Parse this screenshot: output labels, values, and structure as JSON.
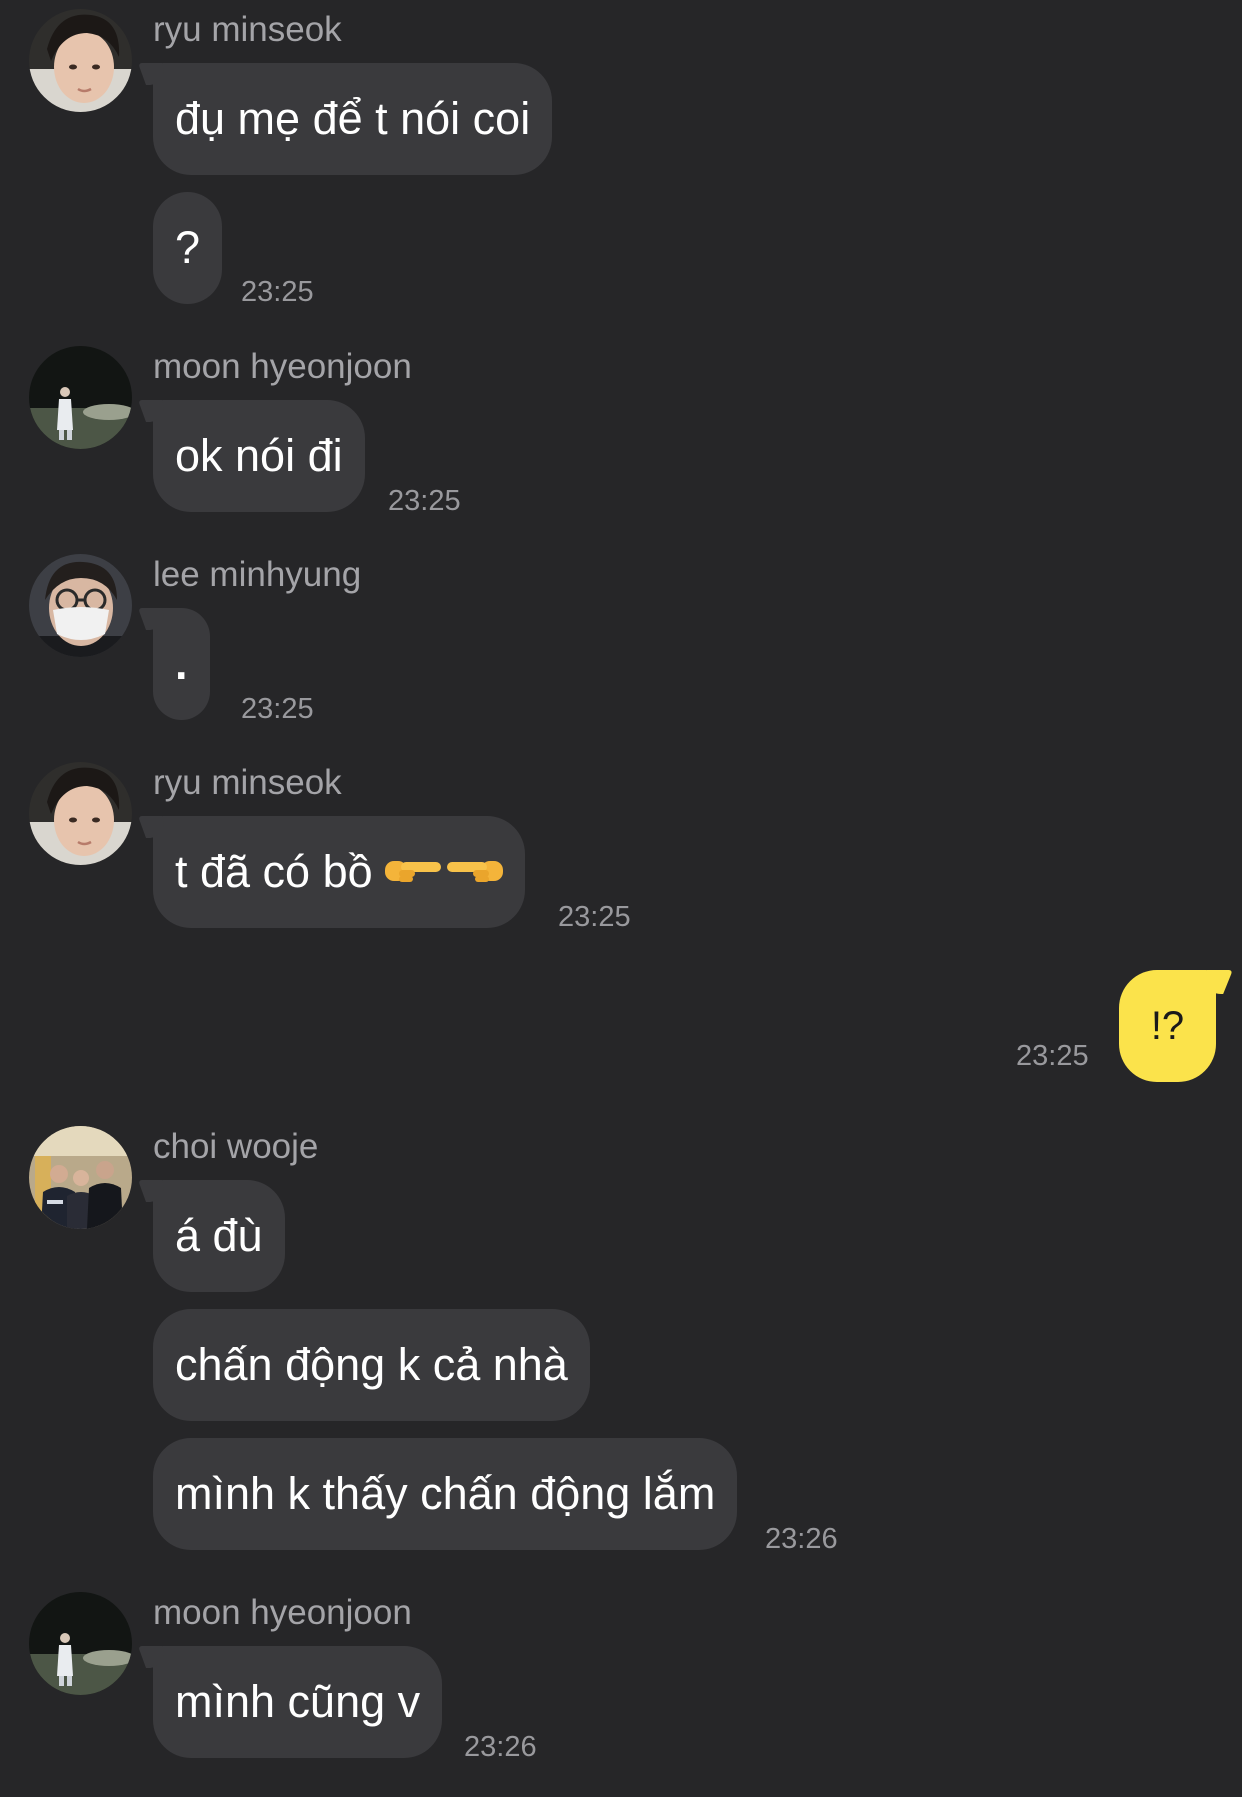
{
  "colors": {
    "background": "#262628",
    "incoming_bubble": "#3a3a3d",
    "outgoing_bubble": "#fbe34b",
    "sender_name": "#a4a4a8",
    "timestamp": "#99999d"
  },
  "messages": [
    {
      "sender": "ryu minseok",
      "avatar_icon": "profile-photo-ryu-minseok",
      "bubbles": [
        "đụ mẹ để t nói coi",
        "?"
      ],
      "time": "23:25"
    },
    {
      "sender": "moon hyeonjoon",
      "avatar_icon": "profile-photo-moon-hyeonjoon",
      "bubbles": [
        "ok nói đi"
      ],
      "time": "23:25"
    },
    {
      "sender": "lee minhyung",
      "avatar_icon": "profile-photo-lee-minhyung",
      "bubbles": [
        "."
      ],
      "time": "23:25"
    },
    {
      "sender": "ryu minseok",
      "avatar_icon": "profile-photo-ryu-minseok",
      "bubbles": [
        "t đã có bồ"
      ],
      "emoji_icons": [
        "pointing-right-icon",
        "pointing-left-icon"
      ],
      "time": "23:25"
    },
    {
      "sender": "me",
      "bubbles": [
        "!?"
      ],
      "time": "23:25"
    },
    {
      "sender": "choi wooje",
      "avatar_icon": "profile-photo-choi-wooje",
      "bubbles": [
        "á đù",
        "chấn động k cả nhà",
        "mình k thấy chấn động lắm"
      ],
      "time": "23:26"
    },
    {
      "sender": "moon hyeonjoon",
      "avatar_icon": "profile-photo-moon-hyeonjoon",
      "bubbles": [
        "mình cũng v"
      ],
      "time": "23:26"
    }
  ]
}
